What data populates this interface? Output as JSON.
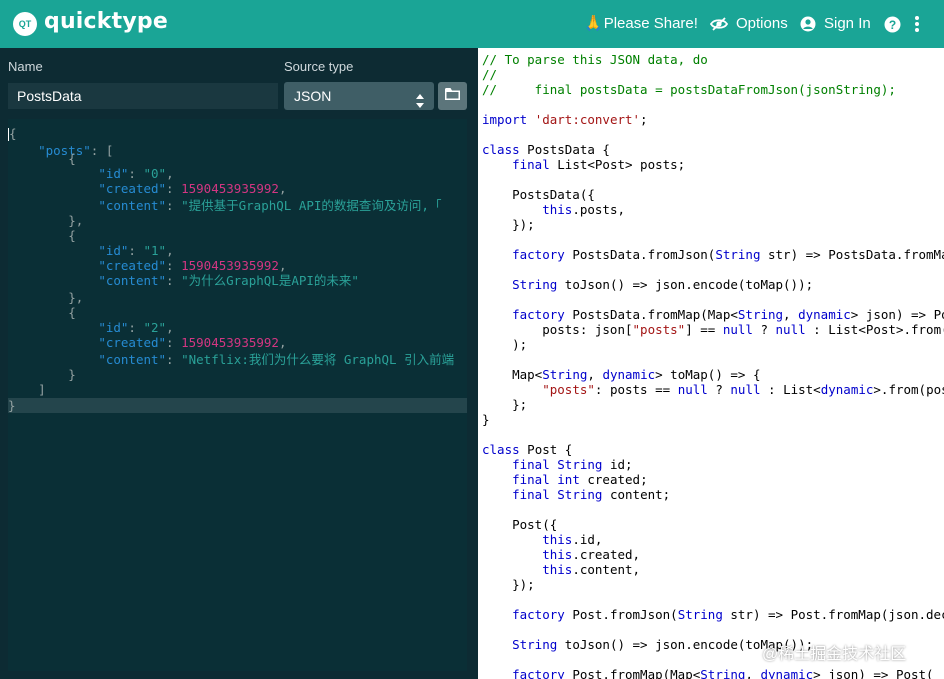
{
  "header": {
    "logo_text": "QT",
    "app_name": "quicktype",
    "share_emoji": "🙏",
    "share_label": "Please Share!",
    "options_label": "Options",
    "signin_label": "Sign In",
    "help_icon": "question-circle-icon",
    "more_icon": "vertical-dots-icon"
  },
  "form": {
    "name_label": "Name",
    "name_value": "PostsData",
    "source_label": "Source type",
    "source_value": "JSON",
    "folder_icon": "folder-icon"
  },
  "json_lines": [
    "{",
    "    \"posts\": [",
    "        {",
    "            \"id\": \"0\",",
    "            \"created\": 1590453935992,",
    "            \"content\": \"提供基于GraphQL API的数据查询及访问,「",
    "        },",
    "        {",
    "            \"id\": \"1\",",
    "            \"created\": 1590453935992,",
    "            \"content\": \"为什么GraphQL是API的未来\"",
    "        },",
    "        {",
    "            \"id\": \"2\",",
    "            \"created\": 1590453935992,",
    "            \"content\": \"Netflix:我们为什么要将 GraphQL 引入前端",
    "        }",
    "    ]",
    "}"
  ],
  "dart_lines": [
    "// To parse this JSON data, do",
    "//",
    "//     final postsData = postsDataFromJson(jsonString);",
    "",
    "import 'dart:convert';",
    "",
    "class PostsData {",
    "    final List<Post> posts;",
    "",
    "    PostsData({",
    "        this.posts,",
    "    });",
    "",
    "    factory PostsData.fromJson(String str) => PostsData.fromMap(json.decode(str));",
    "",
    "    String toJson() => json.encode(toMap());",
    "",
    "    factory PostsData.fromMap(Map<String, dynamic> json) => PostsData(",
    "        posts: json[\"posts\"] == null ? null : List<Post>.from(json[\"posts\"].map((x) => Post.fromMap(x))),",
    "    );",
    "",
    "    Map<String, dynamic> toMap() => {",
    "        \"posts\": posts == null ? null : List<dynamic>.from(posts.map((x) => x.toMap())),",
    "    };",
    "}",
    "",
    "class Post {",
    "    final String id;",
    "    final int created;",
    "    final String content;",
    "",
    "    Post({",
    "        this.id,",
    "        this.created,",
    "        this.content,",
    "    });",
    "",
    "    factory Post.fromJson(String str) => Post.fromMap(json.decode(str));",
    "",
    "    String toJson() => json.encode(toMap());",
    "",
    "    factory Post.fromMap(Map<String, dynamic> json) => Post("
  ],
  "watermark": "@稀土掘金技术社区",
  "colors": {
    "header_bg": "#1aa596",
    "sidebar_bg": "#0d2b33",
    "json_key": "#268bd2",
    "json_string": "#2aa198",
    "json_number": "#d33682",
    "dart_keyword": "#0000cc",
    "dart_string": "#a31515",
    "dart_comment": "#008000"
  }
}
